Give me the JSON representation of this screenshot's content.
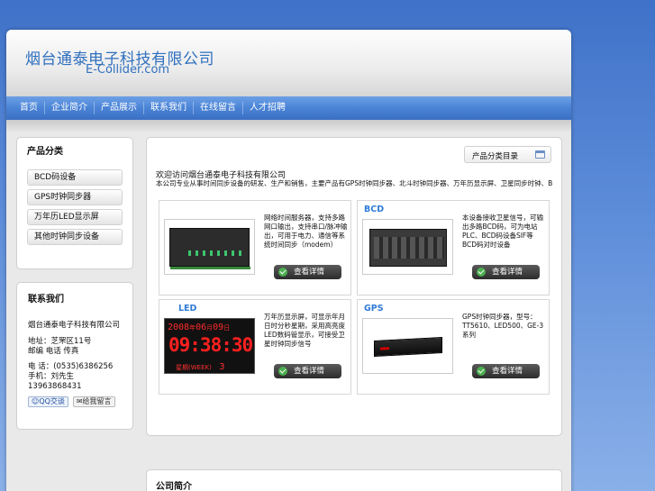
{
  "header": {
    "company_cn": "烟台通泰电子科技有限公司",
    "company_en": "E-Collider.com"
  },
  "nav": [
    {
      "label": "首页"
    },
    {
      "label": "企业简介"
    },
    {
      "label": "产品展示"
    },
    {
      "label": "联系我们"
    },
    {
      "label": "在线留言"
    },
    {
      "label": "人才招聘"
    }
  ],
  "sidebar": {
    "products_title": "产品分类",
    "products": [
      {
        "label": "BCD码设备"
      },
      {
        "label": "GPS时钟同步器"
      },
      {
        "label": "万年历LED显示屏"
      },
      {
        "label": "其他时钟同步设备"
      }
    ],
    "contact_title": "联系我们",
    "contact_lines": [
      "烟台通泰电子科技有限公司",
      "地址：芝罘区11号",
      "邮编 电话 传真",
      "电 话：(0535)6386256",
      "手机：刘先生13963868431"
    ],
    "qq_label": "QQ交谈",
    "msg_label": "给我留言"
  },
  "main": {
    "dropdown_label": "产品分类目录",
    "intro_title": "欢迎访问烟台通泰电子科技有限公司",
    "intro_text": "本公司专业从事时间同步设备的研发、生产和销售，主要产品有GPS时钟同步器、北斗时钟同步器、万年历显示屏、卫星同步时钟、BCD码时钟、网络时间服务器等，产品广泛应用于电力、通信、交通等行业。",
    "products": [
      {
        "tag": "",
        "desc": "网络时间服务器，支持多路网口输出，支持串口/脉冲输出，可用于电力、通信等系统时间同步（modem）",
        "button": "查看详情"
      },
      {
        "tag": "BCD",
        "desc": "本设备接收卫星信号，可输出多路BCD码，可为电站PLC、BCD码设备SIF等BCD码对时设备",
        "button": "查看详情"
      },
      {
        "tag": "LED",
        "desc": "万年历显示屏，可显示年月日时分秒星期，采用高亮度LED数码管显示，可接受卫星时钟同步信号",
        "button": "查看详情"
      },
      {
        "tag": "GPS",
        "desc": "GPS时钟同步器，型号：TT5610、LED500、GE-3系列",
        "button": "查看详情"
      }
    ],
    "clock": {
      "year": "2008",
      "year_unit": "年",
      "month": "06",
      "month_unit": "月",
      "day": "09",
      "day_unit": "日",
      "time": "09:38:30",
      "weekday_label": "星期(WEEK)",
      "weekday": "3"
    },
    "bottom_title": "公司简介"
  },
  "colors": {
    "accent": "#2f6fbd",
    "nav": "#4a83d6",
    "tag": "#2f7bd8"
  }
}
